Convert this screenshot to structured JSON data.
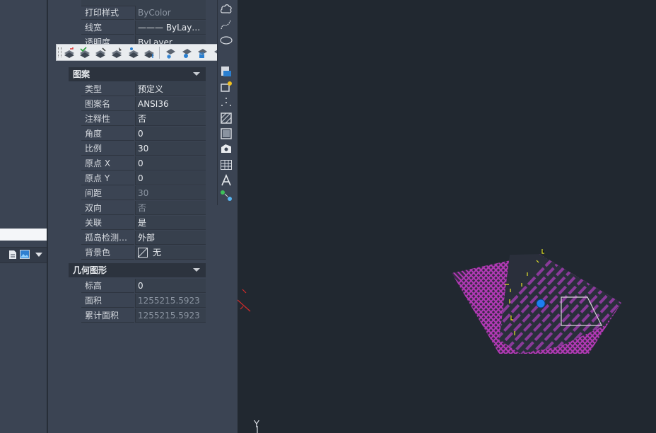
{
  "general_section": {
    "rows": [
      {
        "key": "打印样式",
        "value": "ByColor",
        "muted": true
      },
      {
        "key": "线宽",
        "value": "——— ByLay…",
        "muted": false
      },
      {
        "key": "透明度",
        "value": "ByLayer",
        "muted": false
      }
    ]
  },
  "pattern_section": {
    "title": "图案",
    "rows": [
      {
        "key": "类型",
        "value": "预定义",
        "muted": false
      },
      {
        "key": "图案名",
        "value": "ANSI36",
        "muted": false
      },
      {
        "key": "注释性",
        "value": "否",
        "muted": false
      },
      {
        "key": "角度",
        "value": "0",
        "muted": false
      },
      {
        "key": "比例",
        "value": "30",
        "muted": false
      },
      {
        "key": "原点 X",
        "value": "0",
        "muted": false
      },
      {
        "key": "原点 Y",
        "value": "0",
        "muted": false
      },
      {
        "key": "间距",
        "value": "30",
        "muted": true
      },
      {
        "key": "双向",
        "value": "否",
        "muted": true
      },
      {
        "key": "关联",
        "value": "是",
        "muted": false
      },
      {
        "key": "孤岛检测…",
        "value": "外部",
        "muted": false
      },
      {
        "key": "背景色",
        "value": "无",
        "muted": false
      }
    ]
  },
  "geometry_section": {
    "title": "几何图形",
    "rows": [
      {
        "key": "标高",
        "value": "0",
        "muted": false
      },
      {
        "key": "面积",
        "value": "1255215.5923",
        "muted": true
      },
      {
        "key": "累计面积",
        "value": "1255215.5923",
        "muted": true
      }
    ]
  },
  "toolbar": {
    "close_label": "×",
    "buttons": [
      "layer-previous-icon",
      "layer-match-icon",
      "layer-change-icon",
      "layer-copy-icon",
      "layer-walk-icon",
      "layer-merge-icon",
      "layer-freeze-icon",
      "layer-off-icon",
      "layer-lock-icon",
      "layer-unlock-icon"
    ]
  },
  "palette": {
    "buttons": [
      "revcloud-icon",
      "spline-icon",
      "ellipse-icon",
      "insert-block-icon",
      "create-block-icon",
      "point-icon",
      "hatch-icon",
      "gradient-icon",
      "region-icon",
      "table-icon",
      "text-icon",
      "add-selected-icon"
    ]
  },
  "canvas": {
    "ucs_label": "Y",
    "colors": {
      "hatch": "#b23ab5",
      "hatch_stripe": "#8a3a9a",
      "grip": "#1e7ff0",
      "boundary": "#d8d8d8",
      "ticks": "#e5e52a",
      "axis": "#d22a2a"
    }
  }
}
